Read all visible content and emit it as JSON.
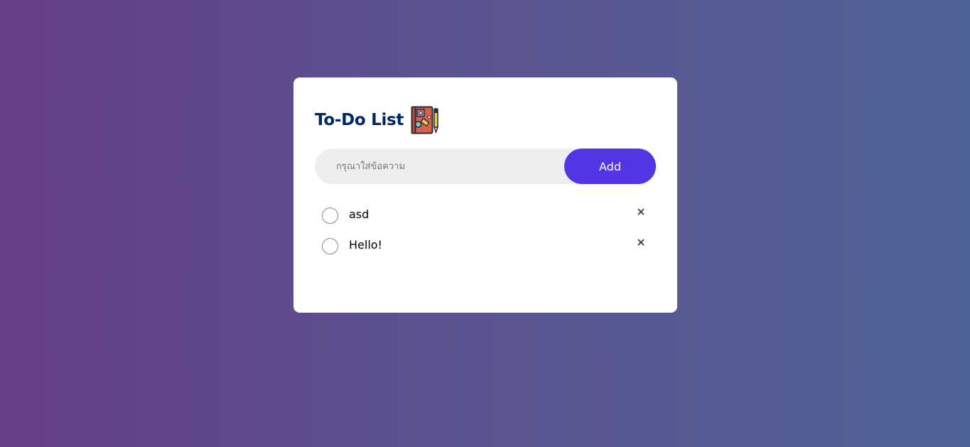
{
  "app": {
    "title": "To-Do List",
    "title_icon": "notebook-pen-icon"
  },
  "input": {
    "placeholder": "กรุณาใส่ข้อความ",
    "value": ""
  },
  "buttons": {
    "add_label": "Add"
  },
  "tasks": [
    {
      "text": "asd",
      "checked": false,
      "delete_icon": "close-icon"
    },
    {
      "text": "Hello!",
      "checked": false,
      "delete_icon": "close-icon"
    }
  ],
  "colors": {
    "accent": "#5435e4",
    "title": "#002765",
    "gradient_start": "#653f86",
    "gradient_end": "#4f6396"
  }
}
